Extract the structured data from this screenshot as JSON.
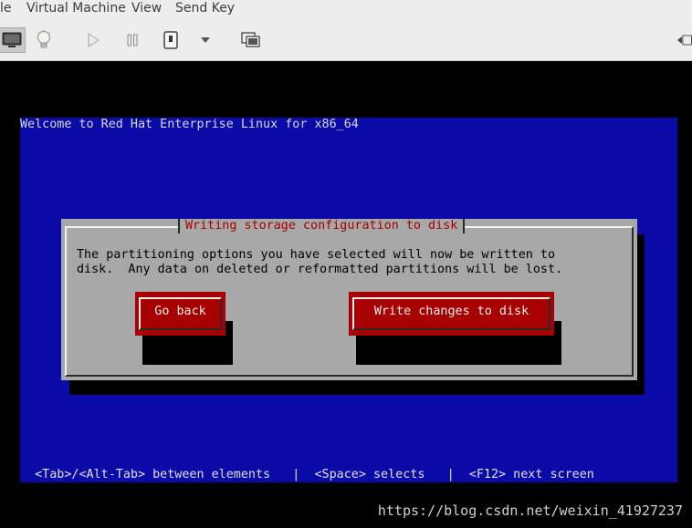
{
  "menubar": {
    "items": [
      "le",
      "Virtual Machine",
      "View",
      "Send Key"
    ]
  },
  "toolbar": {
    "icons": [
      "console-icon",
      "details-lightbulb-icon",
      "run-icon",
      "pause-icon",
      "shutdown-icon",
      "shutdown-menu-icon",
      "snapshot-icon",
      "fullscreen-icon"
    ]
  },
  "installer": {
    "welcome": "Welcome to Red Hat Enterprise Linux for x86_64",
    "dialog": {
      "title": "Writing storage configuration to disk",
      "text_line1": "The partitioning options you have selected will now be written to",
      "text_line2": "disk.  Any data on deleted or reformatted partitions will be lost.",
      "go_back": "Go back",
      "write_changes": "Write changes to disk"
    },
    "status": "  <Tab>/<Alt-Tab> between elements   |  <Space> selects   |  <F12> next screen"
  },
  "colors": {
    "background_blue": "#0a0aa8",
    "dialog_gray": "#a8a8a8",
    "button_red": "#a80000"
  },
  "watermark": "https://blog.csdn.net/weixin_41927237"
}
